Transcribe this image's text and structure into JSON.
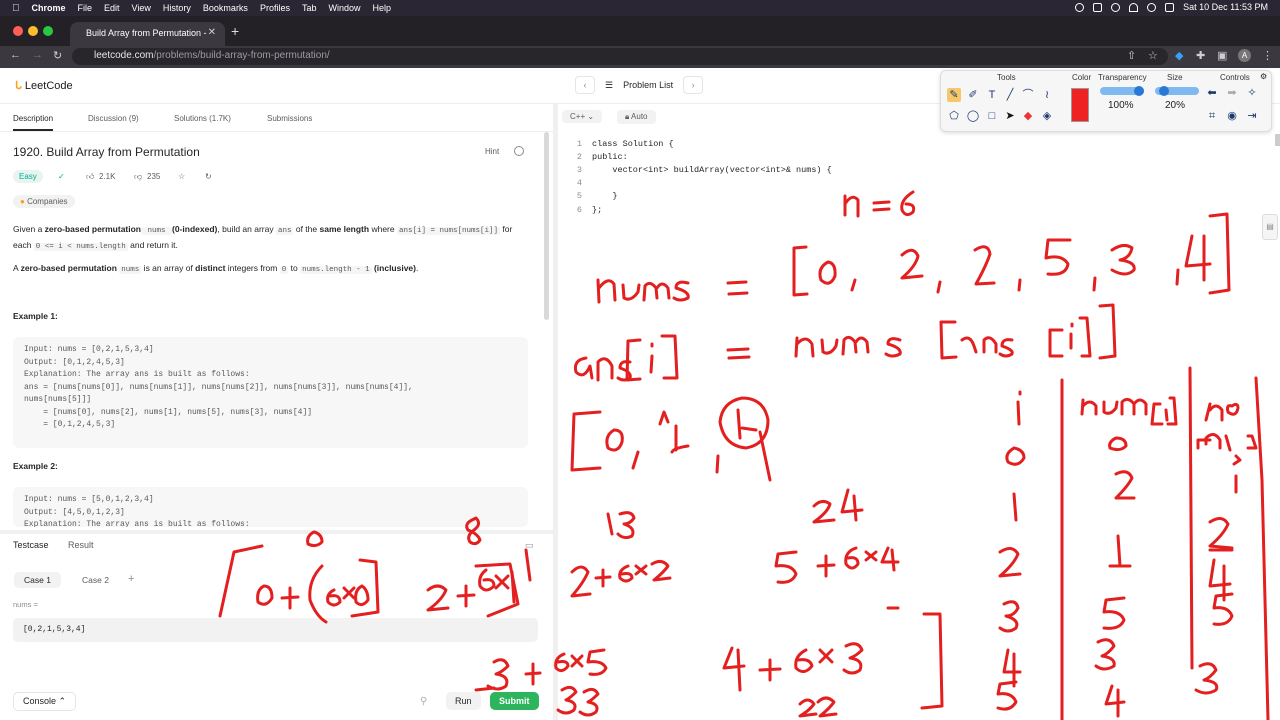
{
  "menubar": {
    "app": "Chrome",
    "items": [
      "File",
      "Edit",
      "View",
      "History",
      "Bookmarks",
      "Profiles",
      "Tab",
      "Window",
      "Help"
    ],
    "datetime": "Sat 10 Dec  11:53 PM"
  },
  "browser": {
    "tab_title": "Build Array from Permutation -",
    "url_host": "leetcode.com",
    "url_path": "/problems/build-array-from-permutation/",
    "profile": "A"
  },
  "leetcode": {
    "logo": "LeetCode",
    "problem_list": "Problem List",
    "tabs": [
      "Description",
      "Discussion (9)",
      "Solutions (1.7K)",
      "Submissions"
    ],
    "title": "1920. Build Array from Permutation",
    "hint": "Hint",
    "difficulty": "Easy",
    "likes": "2.1K",
    "dislikes": "235",
    "companies": "Companies",
    "desc1_a": "Given a ",
    "desc1_b": "zero-based permutation",
    "desc1_c": " nums ",
    "desc1_d": "(0-indexed)",
    "desc1_e": ", build an array ",
    "desc1_f": "ans",
    "desc1_g": " of the ",
    "desc1_h": "same length",
    "desc1_i": " where ",
    "desc1_j": "ans[i] = nums[nums[i]]",
    "desc1_k": " for each ",
    "desc1_l": "0 <= i < nums.length",
    "desc1_m": " and return it.",
    "desc2_a": "A ",
    "desc2_b": "zero-based permutation",
    "desc2_c": "nums",
    "desc2_d": " is an array of ",
    "desc2_e": "distinct",
    "desc2_f": " integers from ",
    "desc2_g": "0",
    "desc2_h": " to ",
    "desc2_i": "nums.length - 1",
    "desc2_j": "(inclusive)",
    "example1_heading": "Example 1:",
    "example1_lines": [
      "Input: nums = [0,2,1,5,3,4]",
      "Output: [0,1,2,4,5,3]",
      "Explanation: The array ans is built as follows:",
      "ans = [nums[nums[0]], nums[nums[1]], nums[nums[2]], nums[nums[3]], nums[nums[4]],",
      "nums[nums[5]]]",
      "    = [nums[0], nums[2], nums[1], nums[5], nums[3], nums[4]]",
      "    = [0,1,2,4,5,3]"
    ],
    "example2_heading": "Example 2:",
    "example2_lines": [
      "Input: nums = [5,0,1,2,3,4]",
      "Output: [4,5,0,1,2,3]",
      "Explanation: The array ans is built as follows:"
    ],
    "testcase_tab": "Testcase",
    "result_tab": "Result",
    "case1": "Case 1",
    "case2": "Case 2",
    "nums_label": "nums =",
    "nums_value": "[0,2,1,5,3,4]",
    "console": "Console",
    "run": "Run",
    "submit": "Submit"
  },
  "editor": {
    "language": "C++",
    "mode": "Auto",
    "lines": [
      "class Solution {",
      "public:",
      "    vector<int> buildArray(vector<int>& nums) {",
      "",
      "    }",
      "};"
    ]
  },
  "annotation_toolbar": {
    "tools_label": "Tools",
    "color_label": "Color",
    "transparency_label": "Transparency",
    "size_label": "Size",
    "controls_label": "Controls",
    "transparency_value": "100%",
    "size_value": "20%",
    "pen_color": "#ee2222"
  }
}
